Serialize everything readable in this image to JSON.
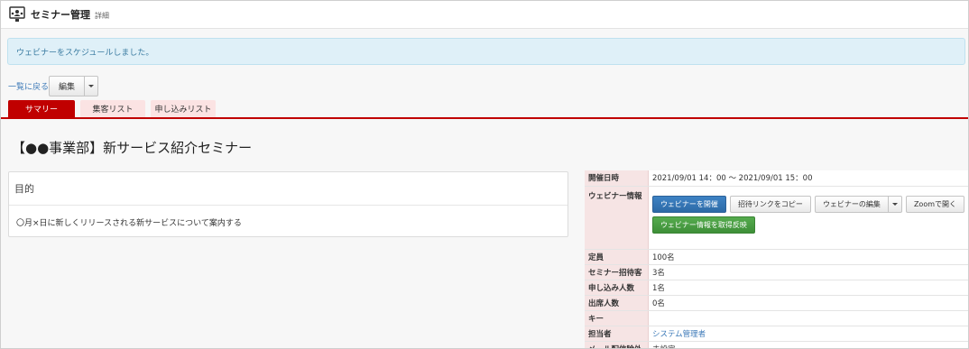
{
  "header": {
    "title": "セミナー管理",
    "subtitle": "詳細",
    "icon": "webinar-icon"
  },
  "alert": {
    "message": "ウェビナーをスケジュールしました。"
  },
  "toolbar": {
    "back_label": "一覧に戻る",
    "edit_label": "編集"
  },
  "tabs": [
    {
      "label": "サマリー",
      "active": true
    },
    {
      "label": "集客リスト",
      "active": false
    },
    {
      "label": "申し込みリスト",
      "active": false
    }
  ],
  "page": {
    "title": "【●●事業部】新サービス紹介セミナー"
  },
  "purpose": {
    "heading": "目的",
    "text": "〇月×日に新しくリリースされる新サービスについて案内する"
  },
  "details": {
    "datetime": {
      "label": "開催日時",
      "value": "2021/09/01 14：00 ～ 2021/09/01 15：00"
    },
    "webinar": {
      "label": "ウェビナー情報",
      "buttons": {
        "start": "ウェビナーを開催",
        "copy_link": "招待リンクをコピー",
        "edit": "ウェビナーの編集",
        "zoom": "Zoomで開く",
        "sync": "ウェビナー情報を取得反映"
      }
    },
    "capacity": {
      "label": "定員",
      "value": "100名"
    },
    "invitees": {
      "label": "セミナー招待客",
      "value": "3名"
    },
    "applicants": {
      "label": "申し込み人数",
      "value": "1名"
    },
    "attendees": {
      "label": "出席人数",
      "value": "0名"
    },
    "key": {
      "label": "キー",
      "value": ""
    },
    "owner": {
      "label": "担当者",
      "value": "システム管理者"
    },
    "mail_exclusion": {
      "label": "メール配信除外",
      "value": "未設定"
    }
  },
  "colors": {
    "accent": "#c00000",
    "tab_bg": "#fbe3e3",
    "primary": "#2d6aa6",
    "success": "#3e8f38"
  }
}
